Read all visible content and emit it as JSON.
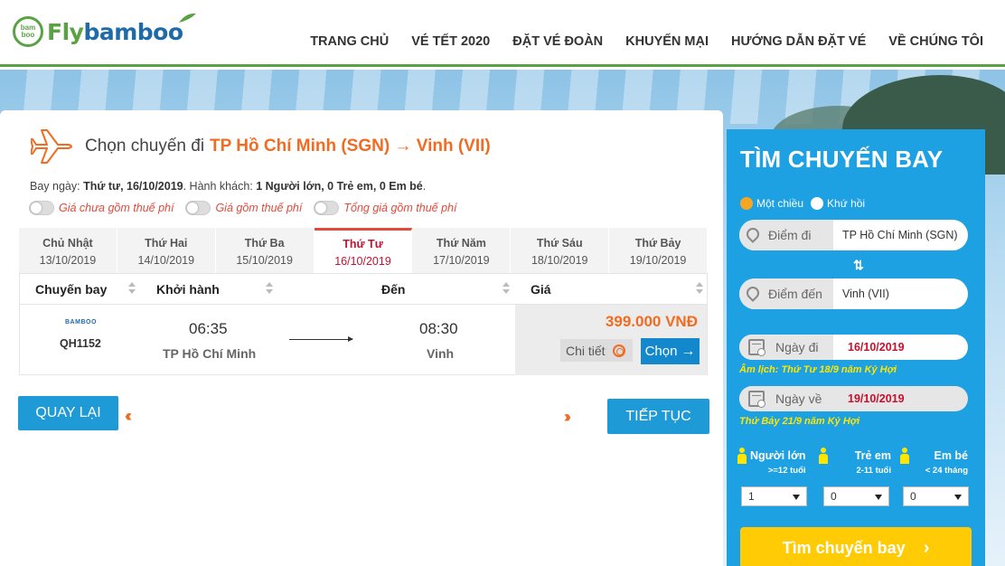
{
  "header": {
    "logo_small": "bam boo",
    "logo_fly": "Fly",
    "logo_bamboo": "bamboo",
    "nav": [
      "TRANG CHỦ",
      "VÉ TẾT 2020",
      "ĐẶT VÉ ĐOÀN",
      "KHUYẾN MẠI",
      "HƯỚNG DẪN ĐẶT VÉ",
      "VỀ CHÚNG TÔI"
    ]
  },
  "main": {
    "title": "Chọn chuyến đi",
    "route": "TP Hồ Chí Minh (SGN) → Vinh (VII)",
    "info": {
      "date_label": "Bay ngày:",
      "date_value": "Thứ tư, 16/10/2019",
      "pax_label": ". Hành khách:",
      "pax_value": "1 Người lớn, 0 Trẻ em, 0 Em bé",
      "end": "."
    },
    "toggles": [
      "Giá chưa gồm thuế phí",
      "Giá gồm thuế phí",
      "Tổng giá gồm thuế phí"
    ],
    "tabs": [
      {
        "day": "Chủ Nhật",
        "date": "13/10/2019"
      },
      {
        "day": "Thứ Hai",
        "date": "14/10/2019"
      },
      {
        "day": "Thứ Ba",
        "date": "15/10/2019"
      },
      {
        "day": "Thứ Tư",
        "date": "16/10/2019"
      },
      {
        "day": "Thứ Năm",
        "date": "17/10/2019"
      },
      {
        "day": "Thứ Sáu",
        "date": "18/10/2019"
      },
      {
        "day": "Thứ Bảy",
        "date": "19/10/2019"
      }
    ],
    "columns": [
      "Chuyến bay",
      "Khởi hành",
      "Đến",
      "Giá"
    ],
    "flight": {
      "airline_logo": "BAMBOO",
      "number": "QH1152",
      "dep_time": "06:35",
      "dep_city": "TP Hồ Chí Minh",
      "arr_time": "08:30",
      "arr_city": "Vinh",
      "price": "399.000 VNĐ",
      "detail_label": "Chi tiết",
      "choose_label": "Chọn"
    },
    "back_label": "QUAY LẠI",
    "next_label": "TIẾP TỤC"
  },
  "search": {
    "title": "TÌM CHUYẾN BAY",
    "trip_types": [
      "Một chiều",
      "Khứ hồi"
    ],
    "selected_trip": "Một chiều",
    "from_label": "Điểm đi",
    "from_value": "TP Hồ Chí Minh (SGN)",
    "to_label": "Điểm đến",
    "to_value": "Vinh (VII)",
    "depart_label": "Ngày đi",
    "depart_value": "16/10/2019",
    "depart_lunar": "Âm lịch: Thứ Tư 18/9 năm Kỷ Hợi",
    "return_label": "Ngày về",
    "return_value": "19/10/2019",
    "return_lunar": "Thứ Bảy 21/9 năm Kỷ Hợi",
    "pax": [
      {
        "label": "Người lớn",
        "sub": ">=12 tuổi",
        "value": "1"
      },
      {
        "label": "Trẻ em",
        "sub": "2-11 tuổi",
        "value": "0"
      },
      {
        "label": "Em bé",
        "sub": "< 24 tháng",
        "value": "0"
      }
    ],
    "button_label": "Tìm chuyến bay"
  },
  "colors": {
    "accent_green": "#5aa244",
    "accent_orange": "#f26b21",
    "panel_blue": "#1da1e2",
    "button_blue": "#1e9ad6",
    "search_yellow": "#ffcb05"
  }
}
